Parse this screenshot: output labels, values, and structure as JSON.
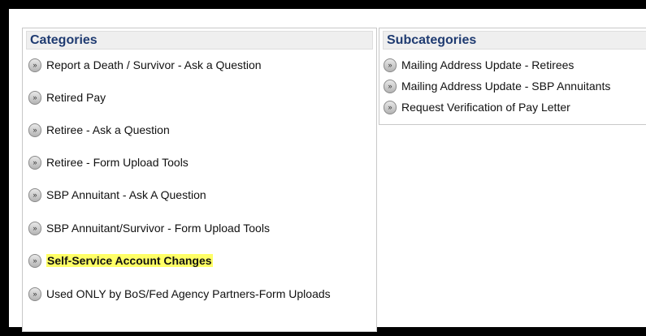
{
  "categories": {
    "title": "Categories",
    "items": [
      {
        "label": "Report a Death / Survivor - Ask a Question"
      },
      {
        "label": "Retired Pay"
      },
      {
        "label": "Retiree - Ask a Question"
      },
      {
        "label": "Retiree - Form Upload Tools"
      },
      {
        "label": "SBP Annuitant - Ask A Question"
      },
      {
        "label": "SBP Annuitant/Survivor - Form Upload Tools"
      },
      {
        "label": "Self-Service Account Changes",
        "selected": true
      },
      {
        "label": "Used ONLY by BoS/Fed Agency Partners-Form Uploads"
      }
    ]
  },
  "subcategories": {
    "title": "Subcategories",
    "items": [
      {
        "label": "Mailing Address Update - Retirees"
      },
      {
        "label": "Mailing Address Update - SBP Annuitants"
      },
      {
        "label": "Request Verification of Pay Letter"
      }
    ]
  },
  "icon": {
    "chevron_glyph": "»",
    "name": "double-chevron-right-icon"
  },
  "colors": {
    "header_text": "#1f3b71",
    "highlight": "#ffff66",
    "frame": "#000000"
  }
}
